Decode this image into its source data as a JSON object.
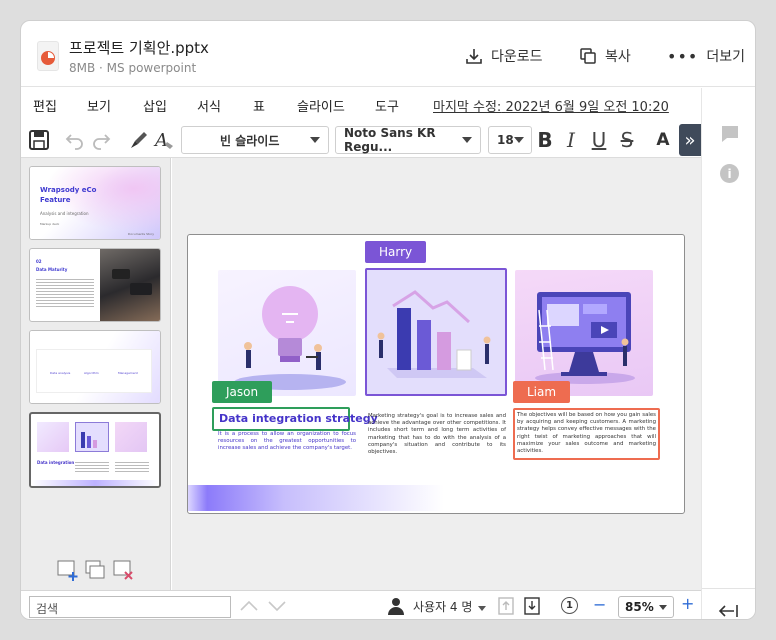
{
  "header": {
    "filename": "프로젝트 기획안.pptx",
    "meta": "8MB · MS powerpoint",
    "download_label": "다운로드",
    "copy_label": "복사",
    "more_label": "더보기"
  },
  "menu": {
    "items": [
      "편집",
      "보기",
      "삽입",
      "서식",
      "표",
      "슬라이드",
      "도구"
    ],
    "modified_label": "마지막 수정:",
    "modified_value": "2022년 6월 9일 오전 10:20"
  },
  "toolbar": {
    "layout_value": "빈 슬라이드",
    "font_value": "Noto Sans KR Regu...",
    "font_size": "18",
    "bold_glyph": "B",
    "italic_glyph": "I",
    "underline_glyph": "U",
    "strike_glyph": "S",
    "text_glyph": "A",
    "more_glyph": "»"
  },
  "thumbnails": [
    {
      "title": "Wrapsody eCo Feature",
      "subtitle": "Analysis and integration",
      "foot": "Markup deck",
      "corner": "Documents Story"
    },
    {
      "title": "Data Maturity",
      "number": "02"
    },
    {
      "labels": [
        "Data analysis",
        "Algorithm",
        "Management"
      ]
    },
    {
      "title": "Data integration strategy"
    }
  ],
  "slide": {
    "tags": {
      "harry": "Harry",
      "jason": "Jason",
      "liam": "Liam"
    },
    "heading": "Data integration strategy",
    "left_text": "It is a process to allow an organization to focus resources on the greatest opportunities to increase sales and achieve the company's target.",
    "middle_text": "Marketing strategy's goal is to increase sales and achieve the advantage over other competitions. It includes short term and long term activities of marketing that has to do with the analysis of a company's situation and contribute to its objectives.",
    "right_text": "The objectives will be based on how you gain sales by acquiring and keeping customers. A marketing strategy helps convey effective messages with the right twist of marketing approaches that will maximize your sales outcome and marketing activities.",
    "colors": {
      "harry": "#7b55d6",
      "jason": "#2e9e5b",
      "liam": "#ee6c50",
      "heading": "#4534c9"
    }
  },
  "status": {
    "search_value": "검색",
    "users_label": "사용자 4 명",
    "zoom_value": "85%",
    "minus": "−",
    "plus": "+"
  }
}
